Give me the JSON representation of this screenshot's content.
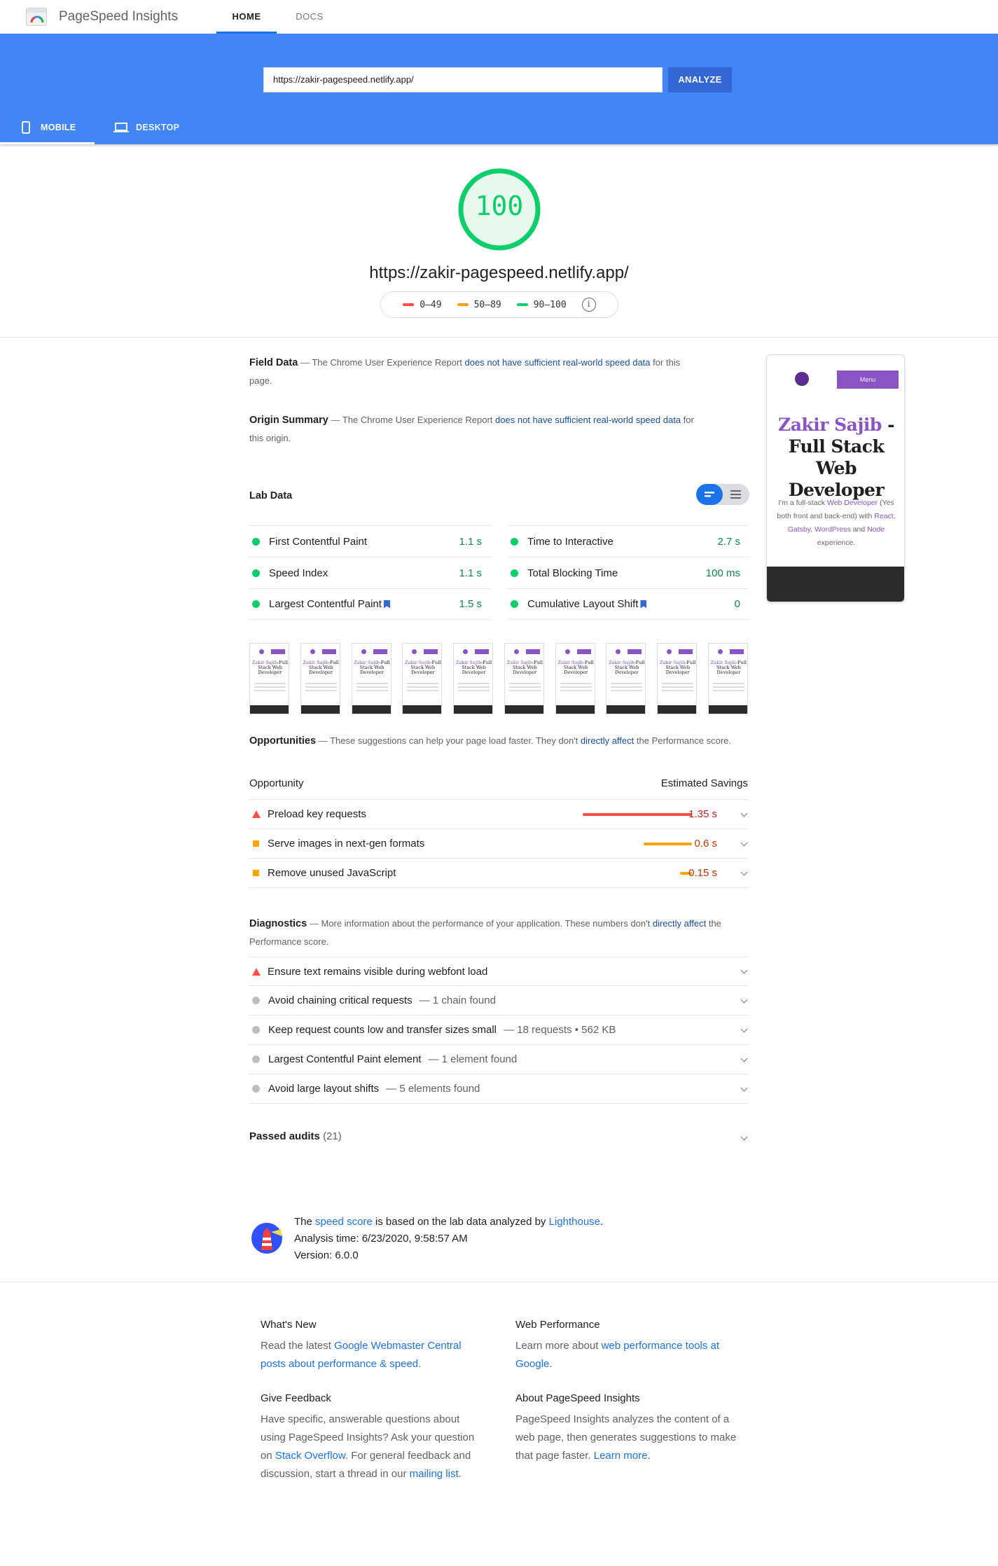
{
  "header": {
    "brand": "PageSpeed Insights",
    "tabs": [
      {
        "label": "HOME"
      },
      {
        "label": "DOCS"
      }
    ]
  },
  "search": {
    "url_value": "https://zakir-pagespeed.netlify.app/",
    "analyze_label": "ANALYZE"
  },
  "device_tabs": [
    {
      "label": "MOBILE",
      "icon": "phone-icon"
    },
    {
      "label": "DESKTOP",
      "icon": "laptop-icon"
    }
  ],
  "score": {
    "value": "100",
    "fraction": 1.0,
    "url": "https://zakir-pagespeed.netlify.app/"
  },
  "legend": [
    {
      "label": "0–49",
      "color": "#ff4e42"
    },
    {
      "label": "50–89",
      "color": "#ffa400"
    },
    {
      "label": "90–100",
      "color": "#0cce6b"
    }
  ],
  "field_data": {
    "title": "Field Data",
    "text_before": "The Chrome User Experience Report",
    "link": "does not have sufficient real-world speed data",
    "text_after": "for this page."
  },
  "origin_summary": {
    "title": "Origin Summary",
    "text_before": "The Chrome User Experience Report",
    "link": "does not have sufficient real-world speed data",
    "text_after": "for this origin."
  },
  "lab_data": {
    "title": "Lab Data",
    "left": [
      {
        "label": "First Contentful Paint",
        "value": "1.1 s",
        "flag": false
      },
      {
        "label": "Speed Index",
        "value": "1.1 s",
        "flag": false
      },
      {
        "label": "Largest Contentful Paint",
        "value": "1.5 s",
        "flag": true
      }
    ],
    "right": [
      {
        "label": "Time to Interactive",
        "value": "2.7 s",
        "flag": false
      },
      {
        "label": "Total Blocking Time",
        "value": "100 ms",
        "flag": false
      },
      {
        "label": "Cumulative Layout Shift",
        "value": "0",
        "flag": true
      }
    ]
  },
  "filmstrip": {
    "frame_count": 10,
    "title_1": "Zakir Sajib",
    "title_2": "-Full Stack Web Developer"
  },
  "opportunities": {
    "title": "Opportunities",
    "text_before": "These suggestions can help your page load faster. They don't",
    "link": "directly affect",
    "text_after": "the Performance score.",
    "col_left": "Opportunity",
    "col_right": "Estimated Savings",
    "rows": [
      {
        "label": "Preload key requests",
        "value": "1.35 s",
        "severity": "fail",
        "color": "#ff4e42",
        "bar_fraction": 1.0
      },
      {
        "label": "Serve images in next-gen formats",
        "value": "0.6 s",
        "severity": "average",
        "color": "#ffa400",
        "bar_fraction": 0.44
      },
      {
        "label": "Remove unused JavaScript",
        "value": "0.15 s",
        "severity": "average",
        "color": "#ffa400",
        "bar_fraction": 0.11
      }
    ]
  },
  "diagnostics": {
    "title": "Diagnostics",
    "text_before": "More information about the performance of your application. These numbers don't",
    "link": "directly affect",
    "text_after": "the Performance score.",
    "rows": [
      {
        "label": "Ensure text remains visible during webfont load",
        "sub": "",
        "severity": "fail"
      },
      {
        "label": "Avoid chaining critical requests",
        "sub": "— 1 chain found",
        "severity": "info"
      },
      {
        "label": "Keep request counts low and transfer sizes small",
        "sub": "— 18 requests • 562 KB",
        "severity": "info"
      },
      {
        "label": "Largest Contentful Paint element",
        "sub": "— 1 element found",
        "severity": "info"
      },
      {
        "label": "Avoid large layout shifts",
        "sub": "— 5 elements found",
        "severity": "info"
      }
    ]
  },
  "passed": {
    "label": "Passed audits",
    "count": "(21)"
  },
  "lighthouse_info": {
    "the": "The",
    "speed_score_link": "speed score",
    "middle": "is based on the lab data analyzed by",
    "lighthouse_link": "Lighthouse",
    "period": ".",
    "analysis_time": "Analysis time: 6/23/2020, 9:58:57 AM",
    "version": "Version: 6.0.0"
  },
  "footer": {
    "whats_new": {
      "title": "What's New",
      "text_before": "Read the latest",
      "link": "Google Webmaster Central posts about performance & speed",
      "text_after": "."
    },
    "web_performance": {
      "title": "Web Performance",
      "text_before": "Learn more about",
      "link": "web performance tools at Google",
      "text_after": "."
    },
    "give_feedback": {
      "title": "Give Feedback",
      "text_before": "Have specific, answerable questions about using PageSpeed Insights? Ask your question on",
      "link1": "Stack Overflow",
      "text_middle": ". For general feedback and discussion, start a thread in our",
      "link2": "mailing list",
      "text_after": "."
    },
    "about": {
      "title": "About PageSpeed Insights",
      "text_before": "PageSpeed Insights analyzes the content of a web page, then generates suggestions to make that page faster.",
      "link": "Learn more",
      "text_after": "."
    }
  },
  "preview": {
    "menu_label": "Menu",
    "title_purple": "Zakir Sajib",
    "title_dark": "-Full Stack Web Developer",
    "desc_1": "I'm a full-stack",
    "desc_link1": "Web Developer",
    "desc_2": "(Yes both front and back-end) with",
    "desc_link2": "React",
    "desc_3": ",",
    "desc_link3": "Gatsby",
    "desc_4": ",",
    "desc_link4": "WordPress",
    "desc_5": "and",
    "desc_link5": "Node",
    "desc_6": "experience."
  },
  "colors": {
    "pass": "#0cce6b",
    "pass_text": "#0a8b46",
    "fail": "#ff4e42",
    "average": "#ffa400",
    "accent": "#4285f4",
    "link": "#1a73e8"
  }
}
